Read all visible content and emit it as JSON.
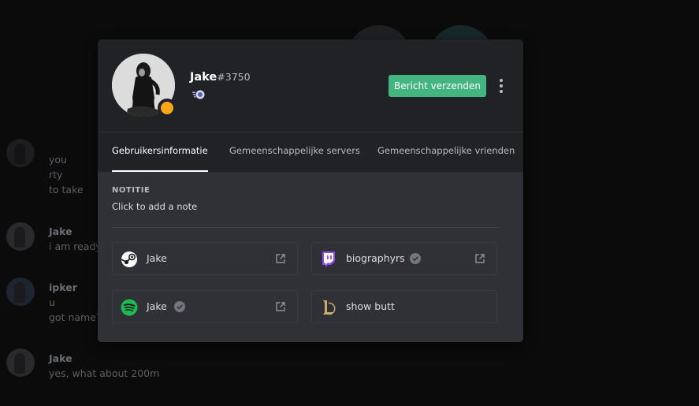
{
  "background": {
    "messages": [
      {
        "text": "you"
      },
      {
        "text": "rty"
      },
      {
        "text": "to take"
      },
      {
        "name": "Jake",
        "text": "i am ready"
      },
      {
        "name": "ipker",
        "text": "u"
      },
      {
        "text": "got name?"
      },
      {
        "name": "Jake",
        "text": "yes, what about 200m"
      }
    ]
  },
  "profile": {
    "username": "Jake",
    "discriminator": "#3750",
    "status": "idle",
    "status_color": "#faa61a",
    "message_button": "Bericht verzenden",
    "more_icon": "more-vertical-icon"
  },
  "tabs": [
    {
      "label": "Gebruikersinformatie",
      "active": true
    },
    {
      "label": "Gemeenschappelijke servers",
      "active": false
    },
    {
      "label": "Gemeenschappelijke vrienden",
      "active": false
    }
  ],
  "note": {
    "title": "NOTITIE",
    "placeholder": "Click to add a note"
  },
  "connections": [
    {
      "service": "steam",
      "icon": "steam-icon",
      "name": "Jake",
      "verified": false,
      "external_link": true
    },
    {
      "service": "twitch",
      "icon": "twitch-icon",
      "name": "biographyrs",
      "verified": true,
      "external_link": true
    },
    {
      "service": "spotify",
      "icon": "spotify-icon",
      "name": "Jake",
      "verified": true,
      "external_link": true
    },
    {
      "service": "league-of-legends",
      "icon": "league-of-legends-icon",
      "name": "show butt",
      "verified": false,
      "external_link": false
    }
  ],
  "colors": {
    "accent_green": "#43b581",
    "modal_header": "#202225",
    "modal_body": "#2f3136",
    "twitch": "#9146ff",
    "spotify": "#1db954",
    "league": "#c8aa6e"
  }
}
